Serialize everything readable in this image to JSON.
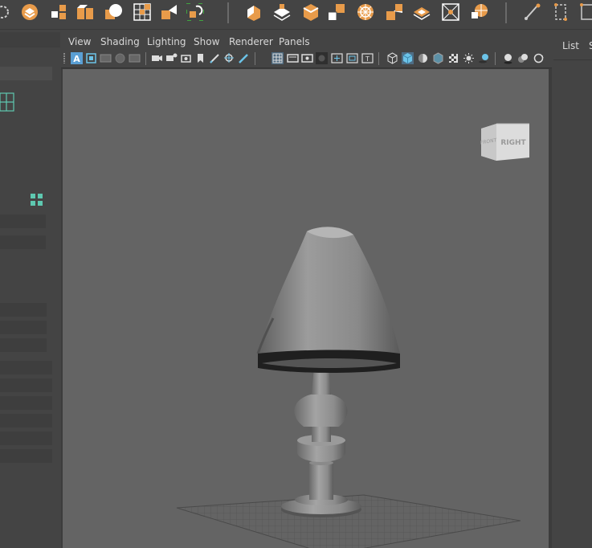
{
  "colors": {
    "accent_orange": "#e89b4a",
    "accent_teal": "#5ec8b0",
    "active_blue": "#5a9fd4",
    "viewport_bg": "#646464"
  },
  "shelf": {
    "icons": [
      "lasso-select-icon",
      "polygon-cube-icon",
      "extract-faces-icon",
      "separate-mesh-icon",
      "smooth-sphere-icon",
      "grid-fill-icon",
      "mirror-icon",
      "uv-snapshot-icon",
      "extrude-icon",
      "bevel-icon",
      "bridge-icon",
      "append-polygon-icon",
      "multi-cut-icon",
      "target-weld-icon",
      "crease-icon",
      "uv-unfold-icon",
      "edge-loop-icon",
      "insert-loop-icon",
      "bend-deformer-icon"
    ]
  },
  "viewport": {
    "menu": [
      "View",
      "Shading",
      "Lighting",
      "Show",
      "Renderer",
      "Panels"
    ],
    "viewcube": {
      "front_label": "FRONT",
      "right_label": "RIGHT"
    }
  },
  "right_panel": {
    "tab_list": "List",
    "tab_next": "S"
  }
}
